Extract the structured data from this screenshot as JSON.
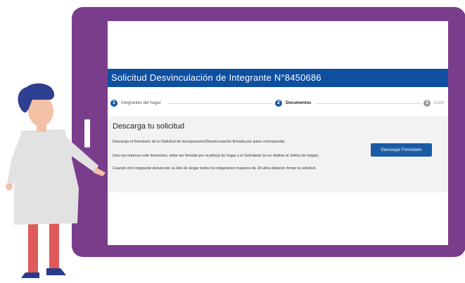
{
  "form": {
    "title": "Solicitud Desvinculación de Integrante N°8450686",
    "steps": [
      {
        "number": "1",
        "label": "Integrantes del hogar"
      },
      {
        "number": "2",
        "label": "Documentos"
      },
      {
        "number": "3",
        "label": "Confi"
      }
    ],
    "section_title": "Descarga tu solicitud",
    "paragraph1": "Descarga el formulario de tu Solicitud de Incorporación/Desvinculación firmada por quien corresponda.",
    "paragraph2": "Una vez impreso este formulario, debe ser firmado por el jefe(a) de hogar y el Solicitante (si es distinto al Jefe(a de Hogar).",
    "paragraph3": "Cuando otro integrante desvincule al Jefe de Hogar todos los integrantes mayores de 18 años deberán firmar la solicitud.",
    "download_button": "Descargar Formulario"
  },
  "colors": {
    "tablet": "#7a3d8b",
    "title_bar": "#0e4fa0",
    "step_active": "#1a5aa6",
    "step_inactive": "#9a9a9a",
    "button": "#1a5aa6"
  }
}
